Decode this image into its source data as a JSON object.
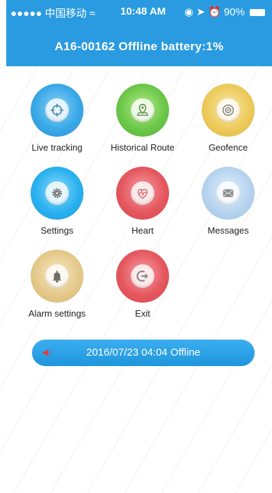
{
  "status_bar": {
    "carrier": "●●●●● 中国移动 ",
    "time": "10:48 AM",
    "battery_percent": "90%"
  },
  "header": {
    "title": "A16-00162 Offline battery:1%"
  },
  "tiles": {
    "live_tracking": {
      "label": "Live tracking",
      "icon": "crosshair-icon"
    },
    "historical_route": {
      "label": "Historical Route",
      "icon": "map-pin-icon"
    },
    "geofence": {
      "label": "Geofence",
      "icon": "target-icon"
    },
    "settings": {
      "label": "Settings",
      "icon": "gear-icon"
    },
    "heart": {
      "label": "Heart",
      "icon": "heart-icon"
    },
    "messages": {
      "label": "Messages",
      "icon": "envelope-icon"
    },
    "alarm_settings": {
      "label": "Alarm settings",
      "icon": "bell-icon"
    },
    "exit": {
      "label": "Exit",
      "icon": "exit-icon"
    }
  },
  "notice": {
    "text": "2016/07/23 04:04 Offline",
    "icon": "speaker-icon"
  },
  "colors": {
    "header_bg": "#2a9be0",
    "notice_bg": "#2aa5e8"
  }
}
